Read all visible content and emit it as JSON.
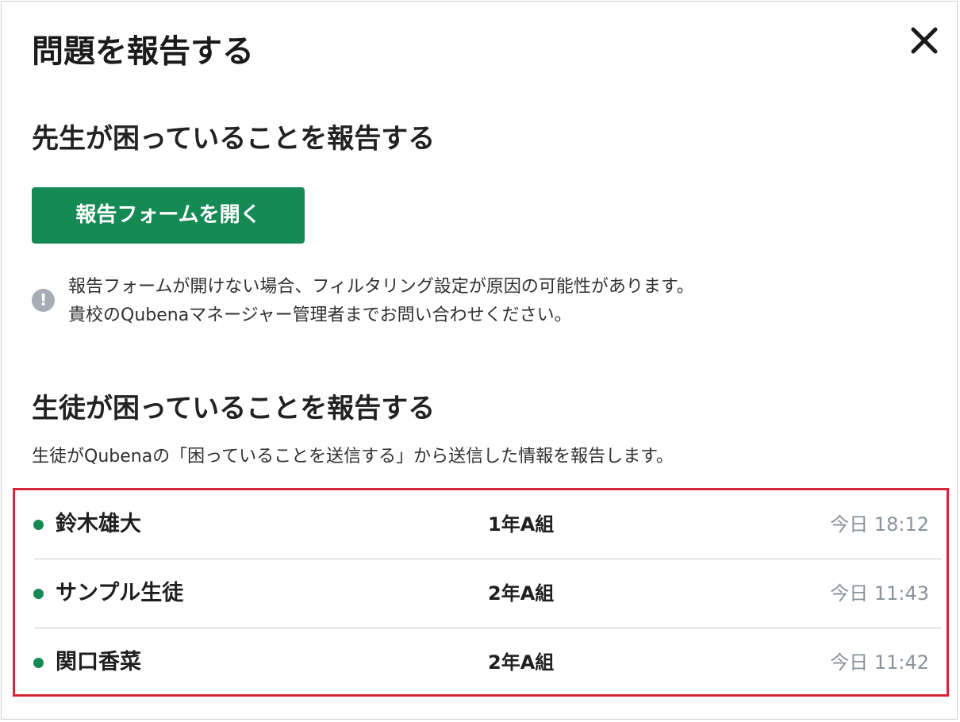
{
  "dialog": {
    "title": "問題を報告する",
    "close_icon": "close-icon"
  },
  "teacher_section": {
    "title": "先生が困っていることを報告する",
    "open_form_button_label": "報告フォームを開く",
    "notice_icon": "exclamation-circle-icon",
    "notice_lines": [
      "報告フォームが開けない場合、フィルタリング設定が原因の可能性があります。",
      "貴校のQubenaマネージャー管理者までお問い合わせください。"
    ]
  },
  "student_section": {
    "title": "生徒が困っていることを報告する",
    "description": "生徒がQubenaの「困っていることを送信する」から送信した情報を報告します。",
    "students": [
      {
        "name": "鈴木雄大",
        "class_name": "1年A組",
        "time": "今日 18:12"
      },
      {
        "name": "サンプル生徒",
        "class_name": "2年A組",
        "time": "今日 11:43"
      },
      {
        "name": "関口香菜",
        "class_name": "2年A組",
        "time": "今日 11:42"
      }
    ]
  },
  "colors": {
    "accent_green": "#168a55",
    "highlight_red": "#d72638",
    "muted_gray": "#8a929b"
  }
}
